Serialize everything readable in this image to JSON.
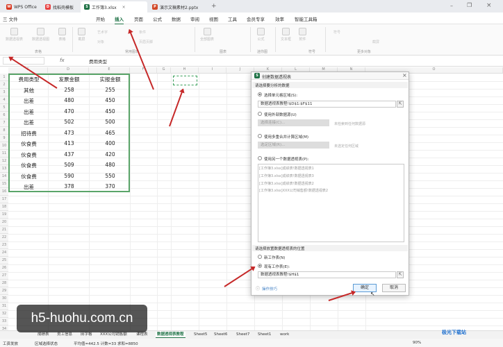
{
  "titlebar": {
    "tabs": [
      {
        "label": "WPS Office",
        "icon": "wps-icon",
        "color": "#d9361e"
      },
      {
        "label": "找稻壳模板",
        "icon": "docer-icon",
        "color": "#e84040"
      },
      {
        "label": "工作簿3.xlsx",
        "icon": "sheet-icon",
        "color": "#1e7145",
        "active": true
      },
      {
        "label": "演示文稿素材2.pptx",
        "icon": "ppt-icon",
        "color": "#d24726"
      }
    ],
    "add": "+"
  },
  "menubar": {
    "file": "三 文件",
    "items": [
      "开始",
      "插入",
      "页面",
      "公式",
      "数据",
      "审阅",
      "视图",
      "工具",
      "会员专享",
      "效率",
      "智能工具箱"
    ],
    "active": "插入"
  },
  "ribbon": {
    "groups": [
      "表格",
      "常用图表",
      "图表",
      "迷你图",
      "符号",
      "更多对象"
    ],
    "items": [
      "数据透视表",
      "数据透视图",
      "表格",
      "截屏",
      "全部图表",
      "公式",
      "文本框",
      "附件",
      "更多"
    ],
    "extra": [
      "艺术字",
      "条件",
      "符号",
      "对象",
      "页眉页脚",
      "截屏"
    ]
  },
  "formulabar": {
    "cell": "",
    "value": "费用类型"
  },
  "columns": [
    "C",
    "D",
    "E",
    "F",
    "G",
    "H",
    "I",
    "J",
    "K",
    "L",
    "M",
    "N",
    "O"
  ],
  "rows": [
    "1",
    "2",
    "3",
    "4",
    "5",
    "6",
    "7",
    "8",
    "9",
    "10",
    "11",
    "12",
    "13",
    "14",
    "15",
    "16",
    "17",
    "18",
    "19",
    "20",
    "21",
    "22",
    "23",
    "24",
    "25",
    "26",
    "27",
    "28",
    "29",
    "30",
    "31",
    "32",
    "33",
    "34"
  ],
  "table": {
    "headers": [
      "费用类型",
      "发票金额",
      "实报金额"
    ],
    "rows": [
      [
        "其他",
        "258",
        "255"
      ],
      [
        "出差",
        "480",
        "450"
      ],
      [
        "出差",
        "470",
        "450"
      ],
      [
        "出差",
        "502",
        "500"
      ],
      [
        "招待费",
        "473",
        "465"
      ],
      [
        "伙食费",
        "413",
        "400"
      ],
      [
        "伙食费",
        "437",
        "420"
      ],
      [
        "伙食费",
        "509",
        "480"
      ],
      [
        "伙食费",
        "590",
        "550"
      ],
      [
        "出差",
        "378",
        "370"
      ]
    ]
  },
  "dialog": {
    "title": "创建数据透视表",
    "section1": "请选择要分析的数据",
    "opt_range": "选择单元格区域(S):",
    "range_value": "数据透视表教程!$D$1:$F$11",
    "opt_external": "使用外部数据源(U)",
    "external_btn": "选择连接(C)...",
    "external_hint": "未检索到任何数据源",
    "opt_multi": "使用多重合并计算区域(M)",
    "multi_btn": "选定区域(R)...",
    "multi_hint": "未选定任何区域",
    "opt_existing": "使用另一个数据透视表(P):",
    "existing_list": [
      "[工作簿3.xlsx]成绩表!数据透视表1",
      "[工作簿3.xlsx]成绩表!数据透视表3",
      "[工作簿3.xlsx]成绩表!数据透视表2",
      "[工作簿3.xlsx]XXX公司销售额!数据透视表2"
    ],
    "section2": "请选择放置数据透视表的位置",
    "opt_new_sheet": "新工作表(N)",
    "opt_existing_sheet": "现有工作表(E):",
    "location_value": "数据透视表教程!$H$1",
    "tips": "操作技巧",
    "ok": "确定",
    "cancel": "取消"
  },
  "sheets": [
    "成绩表",
    "员工信息",
    "田字格",
    "XXX公司销售额",
    "课程表",
    "数据透视表教程",
    "Sheet5",
    "Sheet6",
    "Sheet7",
    "Sheet1",
    "work"
  ],
  "active_sheet": "数据透视表教程",
  "status": {
    "mode": "工资发放",
    "calc": "区域选择状态",
    "stats": "平均值=442.5  计数=33  求和=8850",
    "zoom": "90%"
  },
  "watermark": "h5-huohu.com.cn",
  "logo": "极光下载站"
}
